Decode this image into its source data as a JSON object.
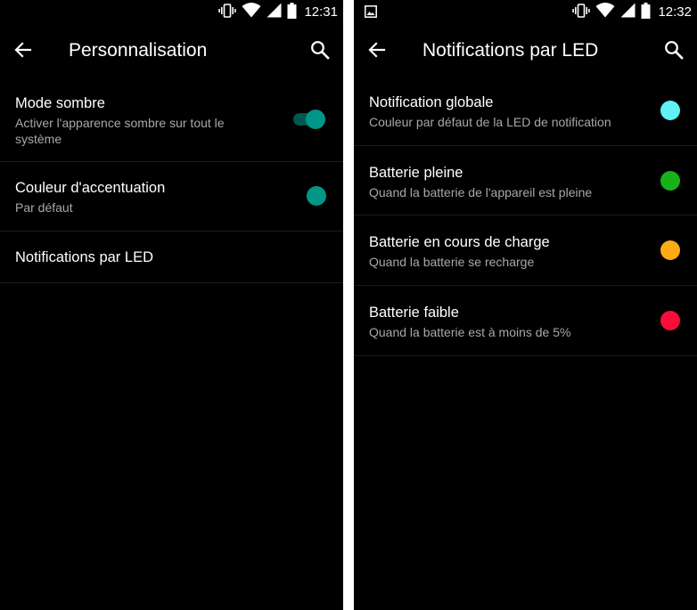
{
  "colors": {
    "accent": "#009688",
    "accent_track": "#00574f"
  },
  "screens": [
    {
      "status_bar": {
        "time": "12:31",
        "icons": [
          "vibrate-icon",
          "wifi-icon",
          "signal-icon",
          "battery-icon"
        ]
      },
      "app_bar": {
        "title": "Personnalisation",
        "back_icon": "arrow-back-icon",
        "search_icon": "search-icon"
      },
      "items": [
        {
          "title": "Mode sombre",
          "summary": "Activer l'apparence sombre sur tout le système",
          "widget": "toggle",
          "checked": true
        },
        {
          "title": "Couleur d'accentuation",
          "summary": "Par défaut",
          "widget": "color-dot",
          "color": "#009688"
        },
        {
          "title": "Notifications par LED",
          "widget": "none"
        }
      ]
    },
    {
      "status_bar": {
        "time": "12:32",
        "icons": [
          "image-notification-icon",
          "vibrate-icon",
          "wifi-icon",
          "signal-icon",
          "battery-icon"
        ]
      },
      "app_bar": {
        "title": "Notifications par LED",
        "back_icon": "arrow-back-icon",
        "search_icon": "search-icon"
      },
      "items": [
        {
          "title": "Notification globale",
          "summary": "Couleur par défaut de la LED de notification",
          "widget": "color-dot",
          "color": "#5ff1f7"
        },
        {
          "title": "Batterie pleine",
          "summary": "Quand la batterie de l'appareil est pleine",
          "widget": "color-dot",
          "color": "#17b217"
        },
        {
          "title": "Batterie en cours de charge",
          "summary": "Quand la batterie se recharge",
          "widget": "color-dot",
          "color": "#fcab15"
        },
        {
          "title": "Batterie faible",
          "summary": "Quand la batterie est à moins de 5%",
          "widget": "color-dot",
          "color": "#fa0d3a"
        }
      ]
    }
  ]
}
